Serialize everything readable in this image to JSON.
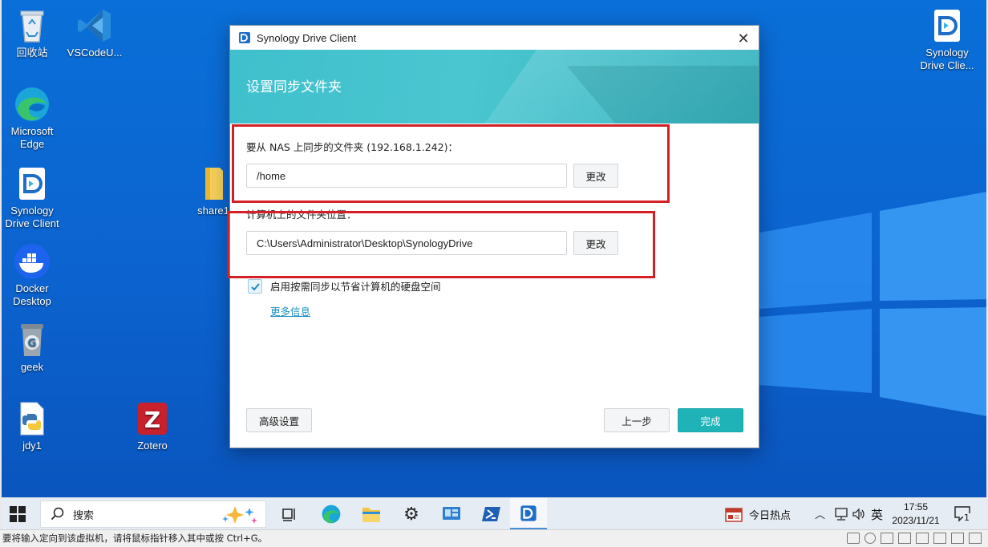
{
  "desktop": {
    "icons": [
      {
        "label": "回收站"
      },
      {
        "label": "VSCodeU..."
      },
      {
        "label": "Microsoft Edge"
      },
      {
        "label": "Synology Drive Client"
      },
      {
        "label": "share1"
      },
      {
        "label": "Docker Desktop"
      },
      {
        "label": "geek"
      },
      {
        "label": "jdy1"
      },
      {
        "label": "Zotero"
      },
      {
        "label": "Synology Drive Clie..."
      }
    ]
  },
  "dialog": {
    "window_title": "Synology Drive Client",
    "heading": "设置同步文件夹",
    "nas_folder_label": "要从 NAS 上同步的文件夹 (192.168.1.242)：",
    "nas_folder_value": "/home",
    "computer_folder_label": "计算机上的文件夹位置：",
    "computer_folder_value": "C:\\Users\\Administrator\\Desktop\\SynologyDrive",
    "change_label": "更改",
    "on_demand_label": "启用按需同步以节省计算机的硬盘空间",
    "on_demand_checked": true,
    "more_info_link": "更多信息",
    "advanced_button": "高级设置",
    "back_button": "上一步",
    "finish_button": "完成"
  },
  "taskbar": {
    "search_placeholder": "搜索",
    "news_label": "今日热点",
    "ime_label": "英",
    "time": "17:55",
    "date": "2023/11/21",
    "notification_count": "1"
  },
  "vm_status": {
    "message": "要将输入定向到该虚拟机，请将鼠标指针移入其中或按 Ctrl+G。"
  },
  "colors": {
    "desktop_blue": "#0c63cf",
    "banner_teal": "#3fc0cc",
    "primary_button": "#1fb3b8",
    "highlight_red": "#d42025",
    "link_blue": "#1a8fc9"
  }
}
